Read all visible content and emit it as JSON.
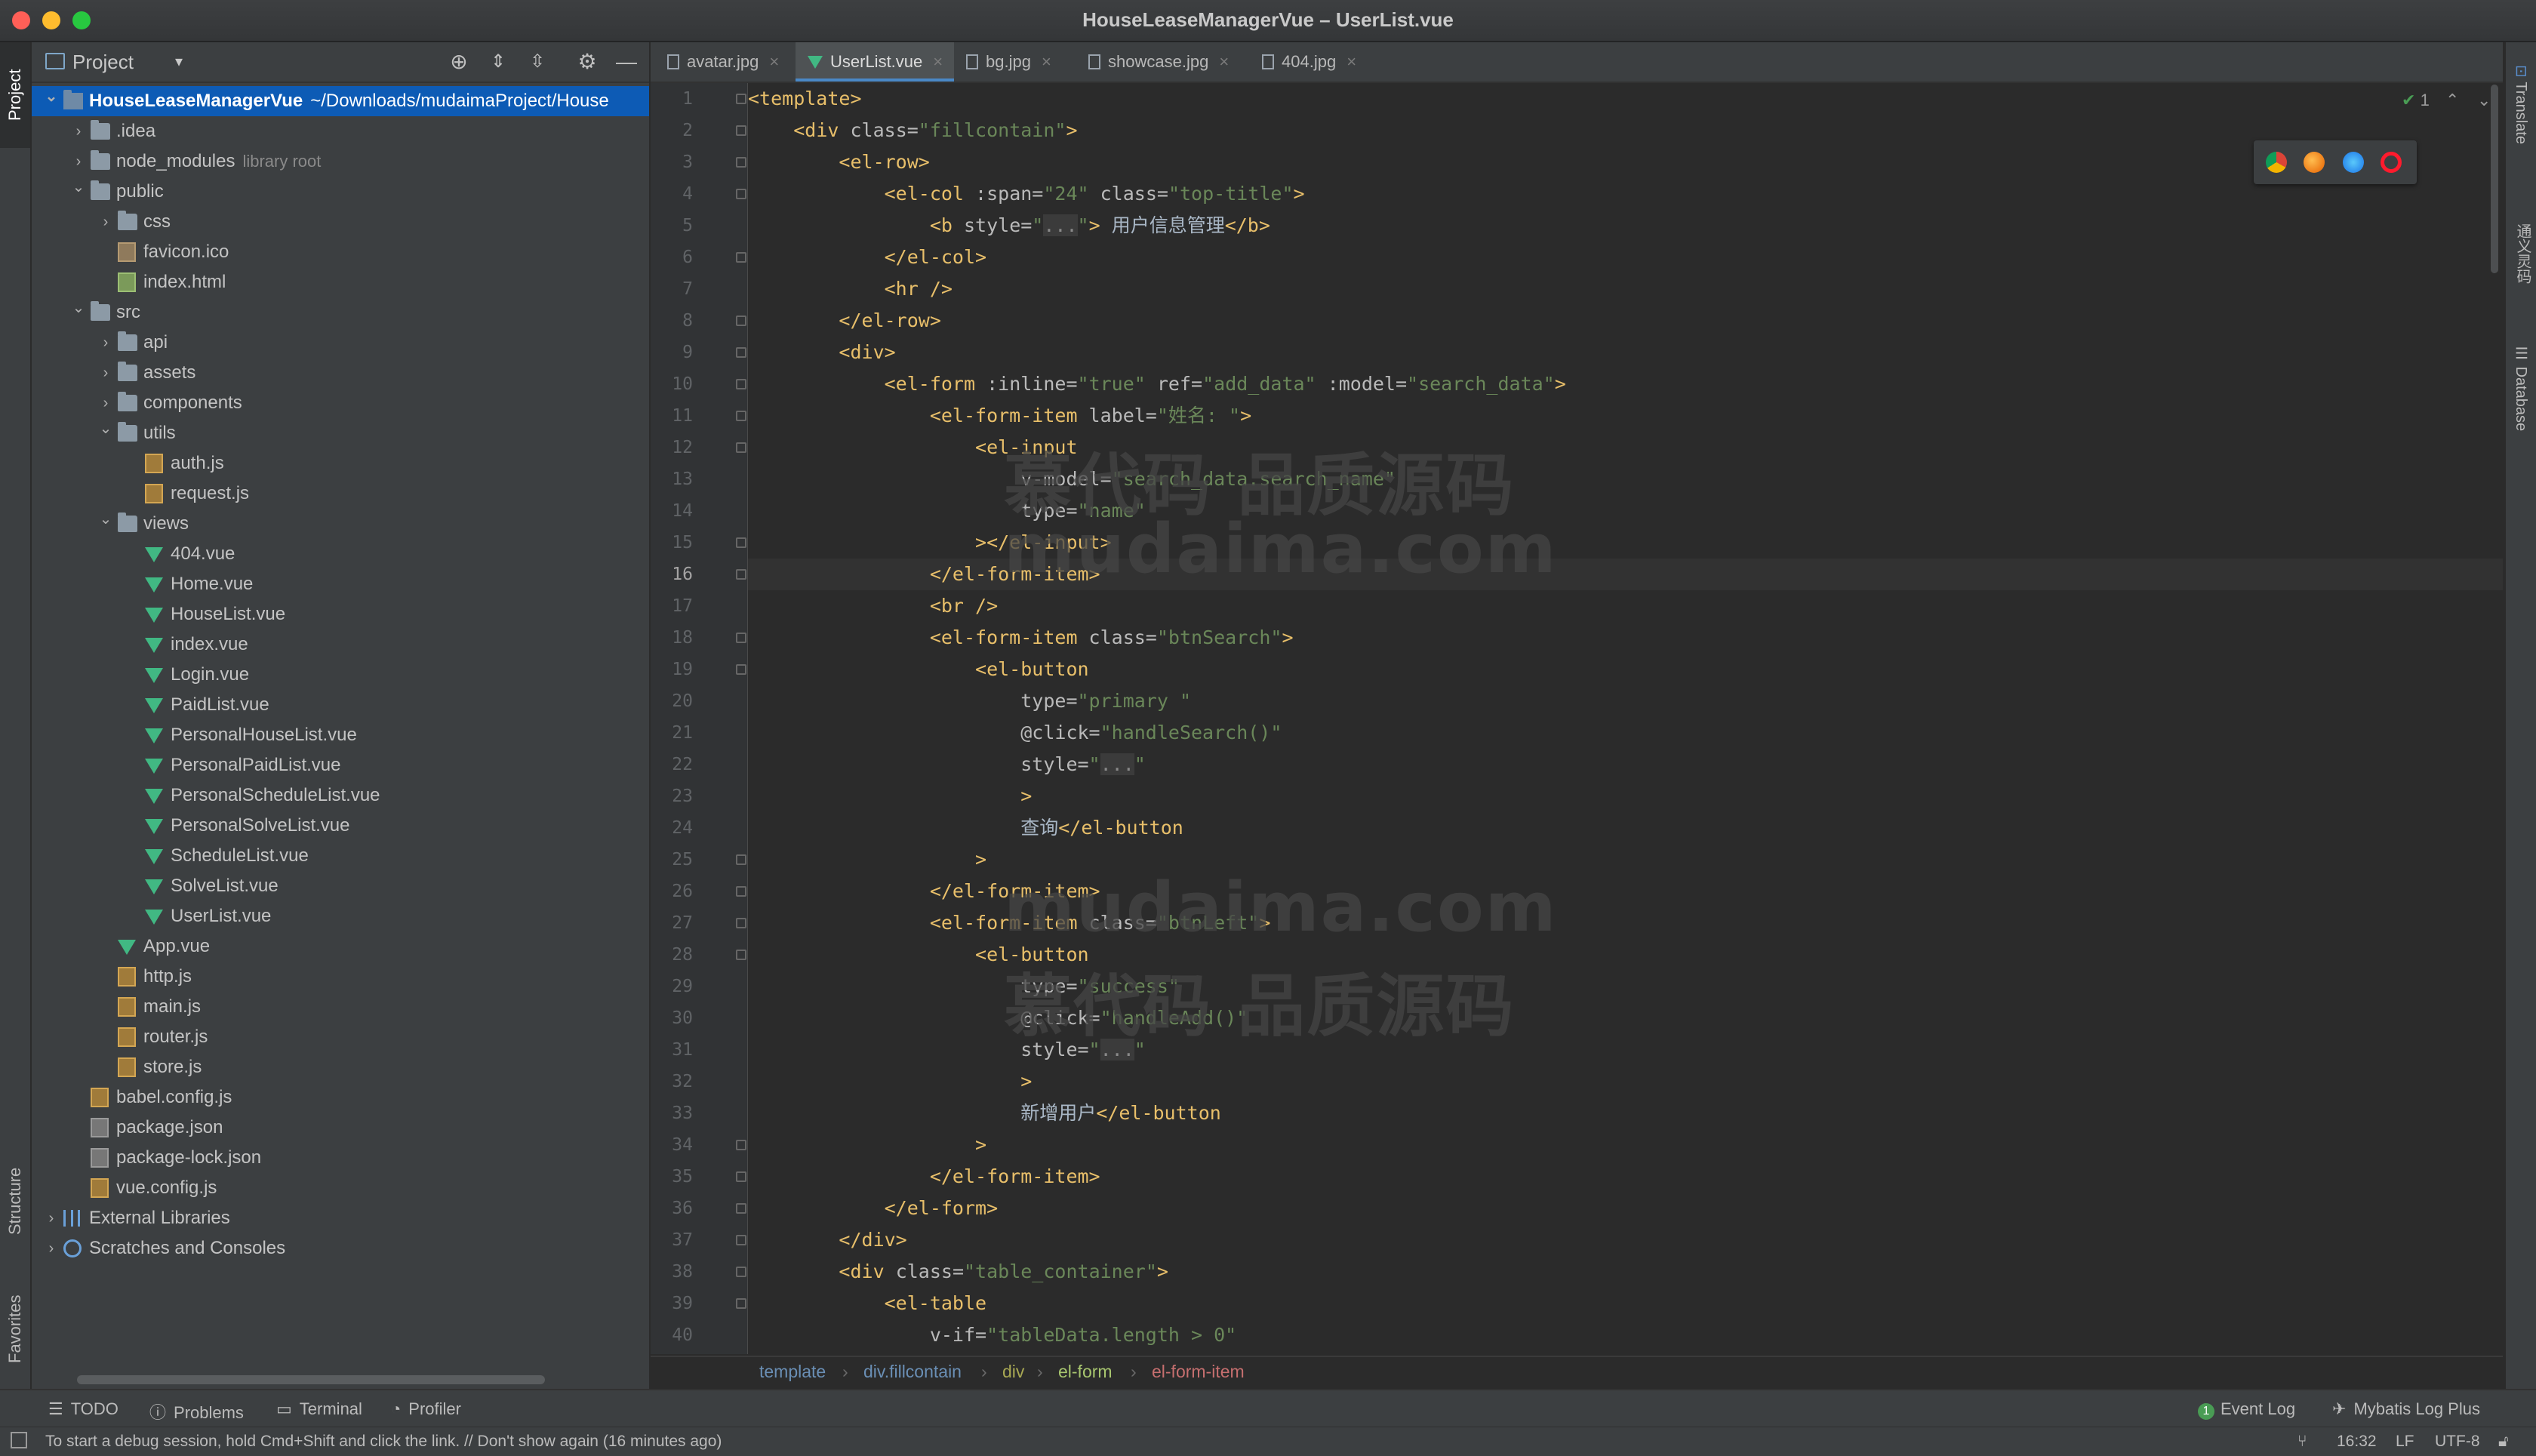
{
  "window": {
    "title": "HouseLeaseManagerVue – UserList.vue"
  },
  "left_strip": {
    "project": "Project",
    "structure": "Structure",
    "favorites": "Favorites"
  },
  "right_strip": {
    "translate": "Translate",
    "notes": "通义灵码",
    "database": "Database"
  },
  "project_panel": {
    "title": "Project",
    "tree": [
      {
        "label": "HouseLeaseManagerVue",
        "suffix": "~/Downloads/mudaimaProject/House",
        "depth": 0,
        "expanded": true,
        "icon": "root-folder-icon",
        "selected": true
      },
      {
        "label": ".idea",
        "depth": 1,
        "expanded": false,
        "icon": "folder-icon"
      },
      {
        "label": "node_modules",
        "suffix": "library root",
        "depth": 1,
        "expanded": false,
        "icon": "folder-icon"
      },
      {
        "label": "public",
        "depth": 1,
        "expanded": true,
        "icon": "folder-icon"
      },
      {
        "label": "css",
        "depth": 2,
        "expanded": false,
        "icon": "folder-icon"
      },
      {
        "label": "favicon.ico",
        "depth": 2,
        "icon": "ico-file-icon"
      },
      {
        "label": "index.html",
        "depth": 2,
        "icon": "html-file-icon"
      },
      {
        "label": "src",
        "depth": 1,
        "expanded": true,
        "icon": "folder-icon"
      },
      {
        "label": "api",
        "depth": 2,
        "expanded": false,
        "icon": "folder-icon"
      },
      {
        "label": "assets",
        "depth": 2,
        "expanded": false,
        "icon": "folder-icon"
      },
      {
        "label": "components",
        "depth": 2,
        "expanded": false,
        "icon": "folder-icon"
      },
      {
        "label": "utils",
        "depth": 2,
        "expanded": true,
        "icon": "folder-icon"
      },
      {
        "label": "auth.js",
        "depth": 3,
        "icon": "js-file-icon"
      },
      {
        "label": "request.js",
        "depth": 3,
        "icon": "js-file-icon"
      },
      {
        "label": "views",
        "depth": 2,
        "expanded": true,
        "icon": "folder-icon"
      },
      {
        "label": "404.vue",
        "depth": 3,
        "icon": "vue-file-icon"
      },
      {
        "label": "Home.vue",
        "depth": 3,
        "icon": "vue-file-icon"
      },
      {
        "label": "HouseList.vue",
        "depth": 3,
        "icon": "vue-file-icon"
      },
      {
        "label": "index.vue",
        "depth": 3,
        "icon": "vue-file-icon"
      },
      {
        "label": "Login.vue",
        "depth": 3,
        "icon": "vue-file-icon"
      },
      {
        "label": "PaidList.vue",
        "depth": 3,
        "icon": "vue-file-icon"
      },
      {
        "label": "PersonalHouseList.vue",
        "depth": 3,
        "icon": "vue-file-icon"
      },
      {
        "label": "PersonalPaidList.vue",
        "depth": 3,
        "icon": "vue-file-icon"
      },
      {
        "label": "PersonalScheduleList.vue",
        "depth": 3,
        "icon": "vue-file-icon"
      },
      {
        "label": "PersonalSolveList.vue",
        "depth": 3,
        "icon": "vue-file-icon"
      },
      {
        "label": "ScheduleList.vue",
        "depth": 3,
        "icon": "vue-file-icon"
      },
      {
        "label": "SolveList.vue",
        "depth": 3,
        "icon": "vue-file-icon"
      },
      {
        "label": "UserList.vue",
        "depth": 3,
        "icon": "vue-file-icon"
      },
      {
        "label": "App.vue",
        "depth": 2,
        "icon": "vue-file-icon"
      },
      {
        "label": "http.js",
        "depth": 2,
        "icon": "js-file-icon"
      },
      {
        "label": "main.js",
        "depth": 2,
        "icon": "js-file-icon"
      },
      {
        "label": "router.js",
        "depth": 2,
        "icon": "js-file-icon"
      },
      {
        "label": "store.js",
        "depth": 2,
        "icon": "js-file-icon"
      },
      {
        "label": "babel.config.js",
        "depth": 1,
        "icon": "js-file-icon"
      },
      {
        "label": "package.json",
        "depth": 1,
        "icon": "json-file-icon"
      },
      {
        "label": "package-lock.json",
        "depth": 1,
        "icon": "json-file-icon"
      },
      {
        "label": "vue.config.js",
        "depth": 1,
        "icon": "js-file-icon"
      },
      {
        "label": "External Libraries",
        "depth": 0,
        "expanded": false,
        "icon": "library-icon"
      },
      {
        "label": "Scratches and Consoles",
        "depth": 0,
        "expanded": false,
        "icon": "scratch-icon"
      }
    ]
  },
  "editor": {
    "tabs": [
      {
        "label": "avatar.jpg",
        "icon": "image-file-icon",
        "active": false
      },
      {
        "label": "UserList.vue",
        "icon": "vue-file-icon",
        "active": true
      },
      {
        "label": "bg.jpg",
        "icon": "image-file-icon",
        "active": false
      },
      {
        "label": "showcase.jpg",
        "icon": "image-file-icon",
        "active": false
      },
      {
        "label": "404.jpg",
        "icon": "image-file-icon",
        "active": false
      }
    ],
    "current_line": 16,
    "inspection_count": "1",
    "lines": [
      [
        [
          "tag",
          "<template>"
        ]
      ],
      [
        [
          "plain",
          "    "
        ],
        [
          "tag",
          "<div "
        ],
        [
          "attr",
          "class="
        ],
        [
          "val",
          "\"fillcontain\""
        ],
        [
          "tag",
          ">"
        ]
      ],
      [
        [
          "plain",
          "        "
        ],
        [
          "tag",
          "<el-row>"
        ]
      ],
      [
        [
          "plain",
          "            "
        ],
        [
          "tag",
          "<el-col "
        ],
        [
          "attr",
          ":span="
        ],
        [
          "val",
          "\"24\" "
        ],
        [
          "attr",
          "class="
        ],
        [
          "val",
          "\"top-title\""
        ],
        [
          "tag",
          ">"
        ]
      ],
      [
        [
          "plain",
          "                "
        ],
        [
          "tag",
          "<b "
        ],
        [
          "attr",
          "style="
        ],
        [
          "val",
          "\""
        ],
        [
          "ellip",
          "..."
        ],
        [
          "val",
          "\""
        ],
        [
          "tag",
          ">"
        ],
        [
          "plain",
          " 用户信息管理"
        ],
        [
          "tag",
          "</b>"
        ]
      ],
      [
        [
          "plain",
          "            "
        ],
        [
          "tag",
          "</el-col>"
        ]
      ],
      [
        [
          "plain",
          "            "
        ],
        [
          "tag",
          "<hr />"
        ]
      ],
      [
        [
          "plain",
          "        "
        ],
        [
          "tag",
          "</el-row>"
        ]
      ],
      [
        [
          "plain",
          "        "
        ],
        [
          "tag",
          "<div>"
        ]
      ],
      [
        [
          "plain",
          "            "
        ],
        [
          "tag",
          "<el-form "
        ],
        [
          "attr",
          ":inline="
        ],
        [
          "val",
          "\"true\" "
        ],
        [
          "attr",
          "ref="
        ],
        [
          "val",
          "\"add_data\" "
        ],
        [
          "attr",
          ":model="
        ],
        [
          "val",
          "\"search_data\""
        ],
        [
          "tag",
          ">"
        ]
      ],
      [
        [
          "plain",
          "                "
        ],
        [
          "tag",
          "<el-form-item "
        ],
        [
          "attr",
          "label="
        ],
        [
          "val",
          "\"姓名: \""
        ],
        [
          "tag",
          ">"
        ]
      ],
      [
        [
          "plain",
          "                    "
        ],
        [
          "tag",
          "<el-input"
        ]
      ],
      [
        [
          "plain",
          "                        "
        ],
        [
          "attr",
          "v-model="
        ],
        [
          "val",
          "\"search_data.search_name\""
        ]
      ],
      [
        [
          "plain",
          "                        "
        ],
        [
          "attr",
          "type="
        ],
        [
          "val",
          "\"name\""
        ]
      ],
      [
        [
          "plain",
          "                    "
        ],
        [
          "tag",
          "></el-input>"
        ]
      ],
      [
        [
          "plain",
          "                "
        ],
        [
          "tag",
          "</el-form-item>"
        ]
      ],
      [
        [
          "plain",
          "                "
        ],
        [
          "tag",
          "<br />"
        ]
      ],
      [
        [
          "plain",
          "                "
        ],
        [
          "tag",
          "<el-form-item "
        ],
        [
          "attr",
          "class="
        ],
        [
          "val",
          "\"btnSearch\""
        ],
        [
          "tag",
          ">"
        ]
      ],
      [
        [
          "plain",
          "                    "
        ],
        [
          "tag",
          "<el-button"
        ]
      ],
      [
        [
          "plain",
          "                        "
        ],
        [
          "attr",
          "type="
        ],
        [
          "val",
          "\"primary \""
        ]
      ],
      [
        [
          "plain",
          "                        "
        ],
        [
          "attr",
          "@click="
        ],
        [
          "val",
          "\"handleSearch()\""
        ]
      ],
      [
        [
          "plain",
          "                        "
        ],
        [
          "attr",
          "style="
        ],
        [
          "val",
          "\""
        ],
        [
          "ellip",
          "..."
        ],
        [
          "val",
          "\""
        ]
      ],
      [
        [
          "plain",
          "                        "
        ],
        [
          "tag",
          ">"
        ]
      ],
      [
        [
          "plain",
          "                        查询"
        ],
        [
          "tag",
          "</el-button"
        ]
      ],
      [
        [
          "plain",
          "                    "
        ],
        [
          "tag",
          ">"
        ]
      ],
      [
        [
          "plain",
          "                "
        ],
        [
          "tag",
          "</el-form-item>"
        ]
      ],
      [
        [
          "plain",
          "                "
        ],
        [
          "tag",
          "<el-form-item "
        ],
        [
          "attr",
          "class="
        ],
        [
          "val",
          "\"btnLeft\""
        ],
        [
          "tag",
          ">"
        ]
      ],
      [
        [
          "plain",
          "                    "
        ],
        [
          "tag",
          "<el-button"
        ]
      ],
      [
        [
          "plain",
          "                        "
        ],
        [
          "attr",
          "type="
        ],
        [
          "val",
          "\"success\""
        ]
      ],
      [
        [
          "plain",
          "                        "
        ],
        [
          "attr",
          "@click="
        ],
        [
          "val",
          "\"handleAdd()\""
        ]
      ],
      [
        [
          "plain",
          "                        "
        ],
        [
          "attr",
          "style="
        ],
        [
          "val",
          "\""
        ],
        [
          "ellip",
          "..."
        ],
        [
          "val",
          "\""
        ]
      ],
      [
        [
          "plain",
          "                        "
        ],
        [
          "tag",
          ">"
        ]
      ],
      [
        [
          "plain",
          "                        新增用户"
        ],
        [
          "tag",
          "</el-button"
        ]
      ],
      [
        [
          "plain",
          "                    "
        ],
        [
          "tag",
          ">"
        ]
      ],
      [
        [
          "plain",
          "                "
        ],
        [
          "tag",
          "</el-form-item>"
        ]
      ],
      [
        [
          "plain",
          "            "
        ],
        [
          "tag",
          "</el-form>"
        ]
      ],
      [
        [
          "plain",
          "        "
        ],
        [
          "tag",
          "</div>"
        ]
      ],
      [
        [
          "plain",
          "        "
        ],
        [
          "tag",
          "<div "
        ],
        [
          "attr",
          "class="
        ],
        [
          "val",
          "\"table_container\""
        ],
        [
          "tag",
          ">"
        ]
      ],
      [
        [
          "plain",
          "            "
        ],
        [
          "tag",
          "<el-table"
        ]
      ],
      [
        [
          "plain",
          "                "
        ],
        [
          "attr",
          "v-if="
        ],
        [
          "val",
          "\"tableData.length > 0\""
        ]
      ]
    ],
    "watermarks": [
      "慕代码 品质源码",
      "mudaima.com",
      "mudaima.com",
      "慕代码 品质源码"
    ],
    "breadcrumb": [
      "template",
      "div.fillcontain",
      "div",
      "el-form",
      "el-form-item"
    ]
  },
  "bottom_bar": {
    "todo": "TODO",
    "problems": "Problems",
    "terminal": "Terminal",
    "profiler": "Profiler",
    "event_log": "Event Log",
    "event_count": "1",
    "mybatis": "Mybatis Log Plus"
  },
  "status_bar": {
    "message": "To start a debug session, hold Cmd+Shift and click the link. // Don't show again (16 minutes ago)",
    "position": "16:32",
    "line_sep": "LF",
    "encoding": "UTF-8"
  },
  "colors": {
    "tag": "#e8bf6a",
    "attr": "#bababa",
    "value": "#6a8759",
    "selection": "#0d5bb5",
    "vue": "#41b883"
  }
}
